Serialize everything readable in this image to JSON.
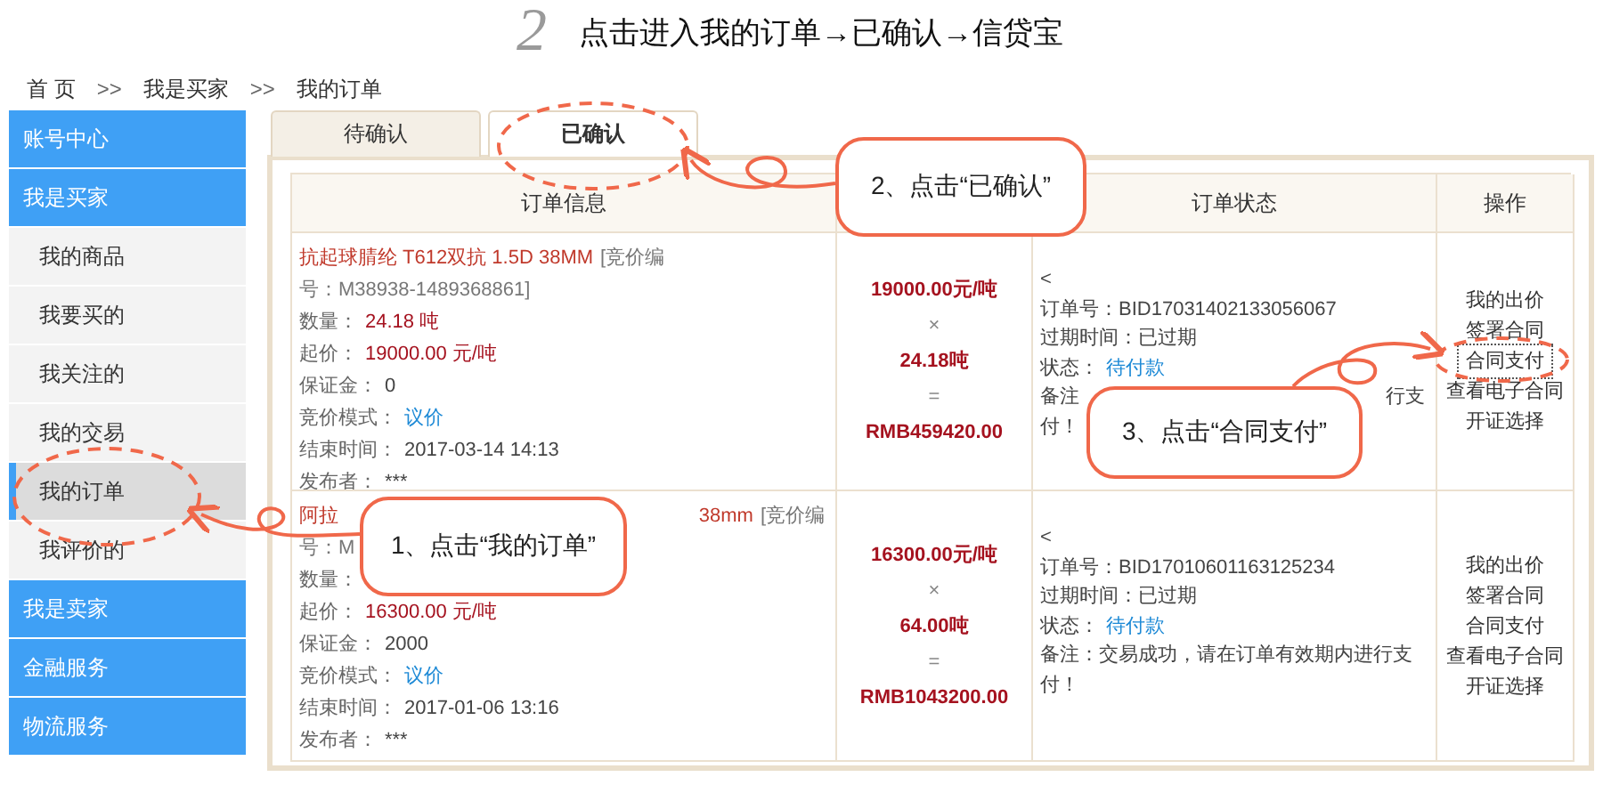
{
  "heading": {
    "step": "2",
    "text": "点击进入我的订单→已确认→信贷宝"
  },
  "breadcrumb": [
    {
      "kind": "link",
      "text": "首 页"
    },
    {
      "kind": "separator",
      "text": ">>"
    },
    {
      "kind": "link",
      "text": "我是买家"
    },
    {
      "kind": "separator",
      "text": ">>"
    },
    {
      "kind": "current",
      "text": "我的订单"
    }
  ],
  "sidebar": [
    {
      "label": "账号中心",
      "kind": "section",
      "selected": false
    },
    {
      "label": "我是买家",
      "kind": "section",
      "selected": false
    },
    {
      "label": "我的商品",
      "kind": "item",
      "selected": false
    },
    {
      "label": "我要买的",
      "kind": "item",
      "selected": false
    },
    {
      "label": "我关注的",
      "kind": "item",
      "selected": false
    },
    {
      "label": "我的交易",
      "kind": "item",
      "selected": false
    },
    {
      "label": "我的订单",
      "kind": "item",
      "selected": true
    },
    {
      "label": "我评价的",
      "kind": "item",
      "selected": false
    },
    {
      "label": "我是卖家",
      "kind": "section",
      "selected": false
    },
    {
      "label": "金融服务",
      "kind": "section",
      "selected": false
    },
    {
      "label": "物流服务",
      "kind": "section",
      "selected": false
    }
  ],
  "tabs": [
    {
      "label": "待确认",
      "selected": false
    },
    {
      "label": "已确认",
      "selected": true
    }
  ],
  "table": {
    "columns": {
      "info": "订单信息",
      "status": "订单状态",
      "actions": "操作"
    },
    "rows": [
      {
        "title_lines": [
          {
            "start": [
              {
                "text": "抗起球腈纶 T612双抗 1.5D 38MM",
                "kind": "product"
              },
              {
                "text": "[竞价编",
                "kind": "code"
              }
            ]
          },
          {
            "start": [
              {
                "text": "号：M38938-1489368861]",
                "kind": "code"
              }
            ]
          }
        ],
        "fields": [
          {
            "label": "数量：",
            "value": "24.18 吨",
            "kind": "emphasis"
          },
          {
            "label": "起价：",
            "value": "19000.00 元/吨",
            "kind": "emphasis"
          },
          {
            "label": "保证金：",
            "value": "0",
            "kind": "plain"
          },
          {
            "label": "竞价模式：",
            "value": "议价",
            "kind": "link"
          },
          {
            "label": "结束时间：",
            "value": "2017-03-14 14:13",
            "kind": "plain"
          },
          {
            "label": "发布者：",
            "value": "***",
            "kind": "plain"
          }
        ],
        "price": {
          "unit_price": "19000.00元/吨",
          "times": "×",
          "quantity": "24.18吨",
          "equals": "=",
          "total": "RMB459420.00"
        },
        "status_lines": [
          {
            "start": [
              {
                "text": "<",
                "kind": "plain"
              }
            ]
          },
          {
            "start": [
              {
                "text": "订单号：BID17031402133056067",
                "kind": "plain"
              }
            ]
          },
          {
            "start": [
              {
                "text": "过期时间：已过期",
                "kind": "plain"
              }
            ]
          },
          {
            "start": [
              {
                "text": "状态：",
                "kind": "plain"
              },
              {
                "text": "待付款",
                "kind": "link"
              }
            ]
          },
          {
            "start": [
              {
                "text": "备注",
                "kind": "plain"
              }
            ],
            "end": [
              {
                "text": "行支",
                "kind": "plain"
              }
            ]
          },
          {
            "start": [
              {
                "text": "付！",
                "kind": "plain"
              }
            ]
          }
        ],
        "actions": [
          {
            "label": "我的出价",
            "focused": false
          },
          {
            "label": "签署合同",
            "focused": false
          },
          {
            "label": "合同支付",
            "focused": true
          },
          {
            "label": "查看电子合同",
            "focused": false
          },
          {
            "label": "开证选择",
            "focused": false
          }
        ]
      },
      {
        "title_lines": [
          {
            "start": [
              {
                "text": "阿拉",
                "kind": "product"
              }
            ],
            "end": [
              {
                "text": "38mm",
                "kind": "product"
              },
              {
                "text": "[竞价编",
                "kind": "code"
              }
            ]
          },
          {
            "start": [
              {
                "text": "号：M",
                "kind": "code"
              }
            ]
          }
        ],
        "fields": [
          {
            "label": "数量："
          },
          {
            "label": "起价：",
            "value": "16300.00 元/吨",
            "kind": "emphasis"
          },
          {
            "label": "保证金：",
            "value": "2000",
            "kind": "plain"
          },
          {
            "label": "竞价模式：",
            "value": "议价",
            "kind": "link"
          },
          {
            "label": "结束时间：",
            "value": "2017-01-06 13:16",
            "kind": "plain"
          },
          {
            "label": "发布者：",
            "value": "***",
            "kind": "plain"
          }
        ],
        "price": {
          "unit_price": "16300.00元/吨",
          "times": "×",
          "quantity": "64.00吨",
          "equals": "=",
          "total": "RMB1043200.00"
        },
        "status_lines": [
          {
            "start": [
              {
                "text": "<",
                "kind": "plain"
              }
            ]
          },
          {
            "start": [
              {
                "text": "订单号：BID17010601163125234",
                "kind": "plain"
              }
            ]
          },
          {
            "start": [
              {
                "text": "过期时间：已过期",
                "kind": "plain"
              }
            ]
          },
          {
            "start": [
              {
                "text": "状态：",
                "kind": "plain"
              },
              {
                "text": "待付款",
                "kind": "link"
              }
            ]
          },
          {
            "start": [
              {
                "text": "备注：交易成功，请在订单有效期内进行支付！",
                "kind": "plain"
              }
            ]
          }
        ],
        "actions": [
          {
            "label": "我的出价",
            "focused": false
          },
          {
            "label": "签署合同",
            "focused": false
          },
          {
            "label": "合同支付",
            "focused": false
          },
          {
            "label": "查看电子合同",
            "focused": false
          },
          {
            "label": "开证选择",
            "focused": false
          }
        ]
      }
    ]
  },
  "callouts": [
    {
      "text": "1、点击“我的订单”"
    },
    {
      "text": "2、点击“已确认”"
    },
    {
      "text": "3、点击“合同支付”"
    }
  ]
}
